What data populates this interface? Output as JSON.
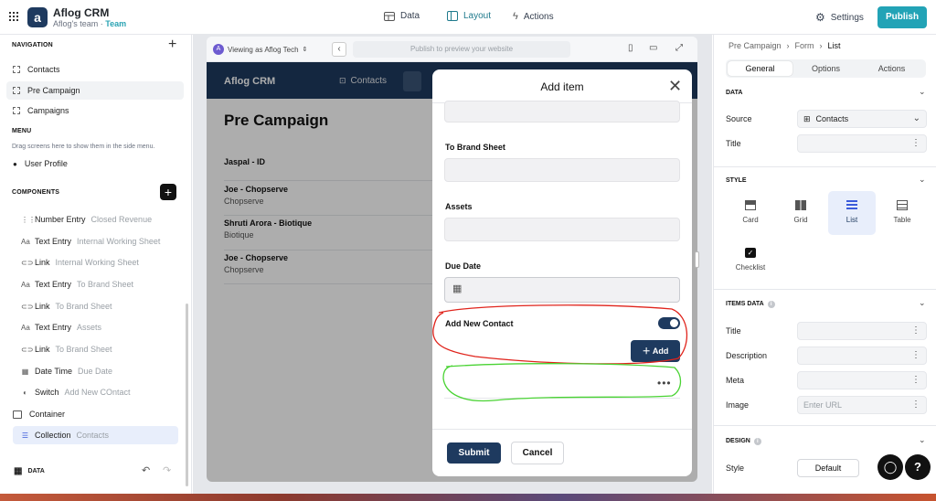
{
  "topbar": {
    "app_name": "Aflog CRM",
    "team_name": "Aflog's team",
    "team_badge": "Team",
    "tabs": [
      {
        "label": "Data"
      },
      {
        "label": "Layout"
      },
      {
        "label": "Actions"
      }
    ],
    "active_tab": "Layout",
    "settings_label": "Settings",
    "publish_label": "Publish"
  },
  "left": {
    "navigation_label": "NAVIGATION",
    "nav_items": [
      {
        "label": "Contacts"
      },
      {
        "label": "Pre Campaign"
      },
      {
        "label": "Campaigns"
      }
    ],
    "menu_label": "MENU",
    "menu_hint": "Drag screens here to show them in the side menu.",
    "user_profile": "User Profile",
    "components_label": "COMPONENTS",
    "components": [
      {
        "type": "Number Entry",
        "name": "Closed Revenue",
        "icon": "number-icon"
      },
      {
        "type": "Text Entry",
        "name": "Internal Working Sheet",
        "icon": "text-icon"
      },
      {
        "type": "Link",
        "name": "Internal Working Sheet",
        "icon": "link-icon"
      },
      {
        "type": "Text Entry",
        "name": "To Brand Sheet",
        "icon": "text-icon"
      },
      {
        "type": "Link",
        "name": "To Brand Sheet",
        "icon": "link-icon"
      },
      {
        "type": "Text Entry",
        "name": "Assets",
        "icon": "text-icon"
      },
      {
        "type": "Link",
        "name": "To Brand Sheet",
        "icon": "link-icon"
      },
      {
        "type": "Date Time",
        "name": "Due Date",
        "icon": "calendar-icon"
      },
      {
        "type": "Switch",
        "name": "Add New COntact",
        "icon": "switch-icon"
      }
    ],
    "container_label": "Container",
    "collection": {
      "type": "Collection",
      "name": "Contacts"
    },
    "data_label": "DATA"
  },
  "preview": {
    "viewing_as": "Viewing as Aflog Tech",
    "avatar_letter": "A",
    "url_placeholder": "Publish to preview your website",
    "app_title": "Aflog CRM",
    "app_tab": "Contacts",
    "page_title": "Pre Campaign",
    "rows": [
      {
        "title": "Jaspal - ID",
        "subtitle": ""
      },
      {
        "title": "Joe - Chopserve",
        "subtitle": "Chopserve"
      },
      {
        "title": "Shruti Arora - Biotique",
        "subtitle": "Biotique"
      },
      {
        "title": "Joe - Chopserve",
        "subtitle": "Chopserve"
      }
    ]
  },
  "modal": {
    "title": "Add item",
    "fields": [
      {
        "label": "To Brand Sheet"
      },
      {
        "label": "Assets"
      },
      {
        "label": "Due Date"
      }
    ],
    "switch_label": "Add New Contact",
    "switch_on": true,
    "add_label": "Add",
    "submit_label": "Submit",
    "cancel_label": "Cancel"
  },
  "right": {
    "breadcrumb": [
      "Pre Campaign",
      "Form",
      "List"
    ],
    "tabs": [
      {
        "label": "General"
      },
      {
        "label": "Options"
      },
      {
        "label": "Actions"
      }
    ],
    "active_tab": "General",
    "data_section": "DATA",
    "source_label": "Source",
    "source_value": "Contacts",
    "title_label": "Title",
    "style_section": "STYLE",
    "style_options": [
      {
        "label": "Card"
      },
      {
        "label": "Grid"
      },
      {
        "label": "List"
      },
      {
        "label": "Table"
      },
      {
        "label": "Checklist"
      }
    ],
    "selected_style": "List",
    "items_section": "ITEMS DATA",
    "items": [
      {
        "label": "Title"
      },
      {
        "label": "Description"
      },
      {
        "label": "Meta"
      },
      {
        "label": "Image"
      }
    ],
    "image_placeholder": "Enter URL",
    "design_section": "DESIGN",
    "style_label": "Style",
    "style_value": "Default"
  },
  "colors": {
    "accent": "#22a3b6",
    "primary": "#1e3a5f",
    "annotation_red": "#e0241c",
    "annotation_green": "#4ad334"
  }
}
